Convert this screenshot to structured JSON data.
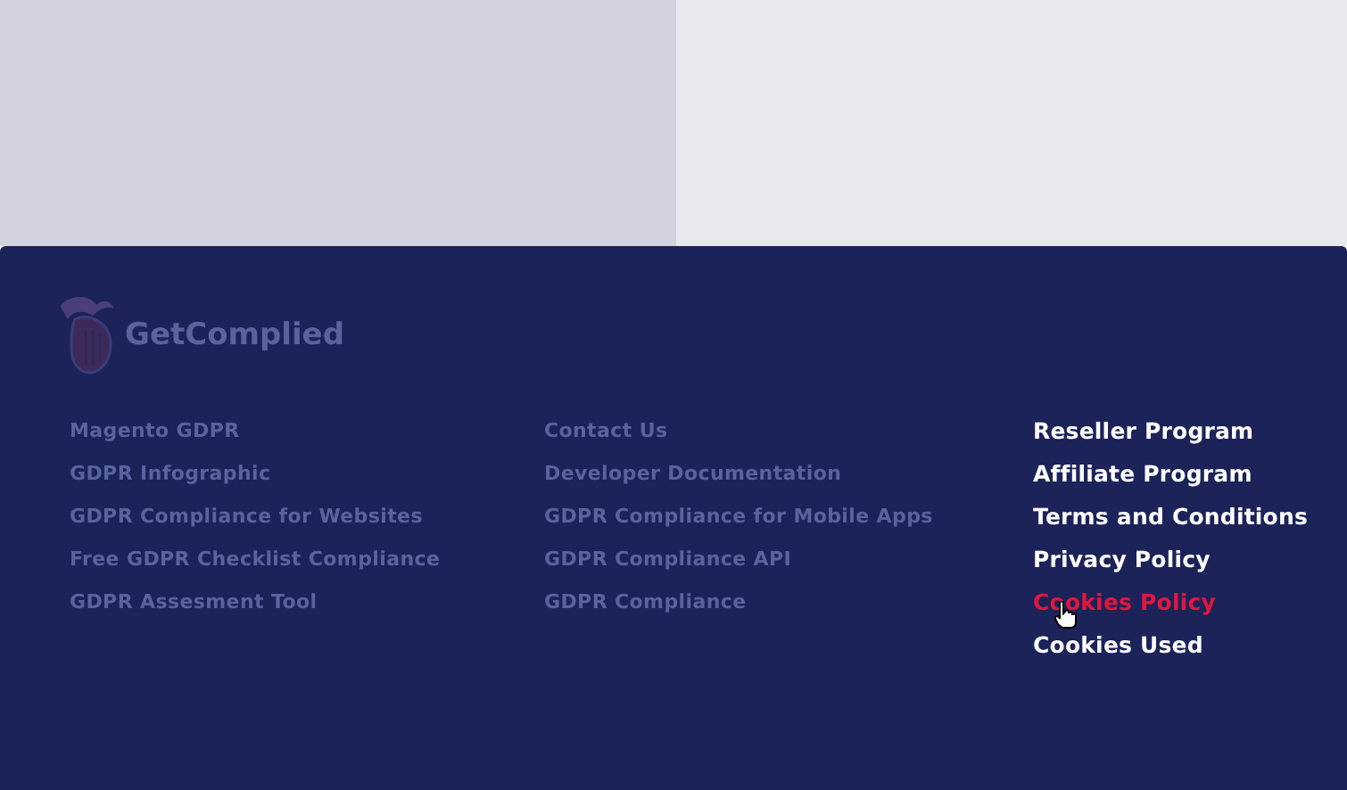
{
  "footer": {
    "logo": {
      "text": "GetComplied",
      "dimmed": true
    },
    "columns": [
      {
        "dimmed": true,
        "links": [
          {
            "label": "Magento GDPR",
            "hovered": false
          },
          {
            "label": "GDPR Infographic",
            "hovered": false
          },
          {
            "label": "GDPR Compliance for Websites",
            "hovered": false
          },
          {
            "label": "Free GDPR Checklist Compliance",
            "hovered": false
          },
          {
            "label": "GDPR Assesment Tool",
            "hovered": false
          }
        ]
      },
      {
        "dimmed": true,
        "links": [
          {
            "label": "Contact Us",
            "hovered": false
          },
          {
            "label": "Developer Documentation",
            "hovered": false
          },
          {
            "label": "GDPR Compliance for Mobile Apps",
            "hovered": false
          },
          {
            "label": "GDPR Compliance API",
            "hovered": false
          },
          {
            "label": "GDPR Compliance",
            "hovered": false
          }
        ]
      },
      {
        "dimmed": false,
        "links": [
          {
            "label": "Reseller Program",
            "hovered": false
          },
          {
            "label": "Affiliate Program",
            "hovered": false
          },
          {
            "label": "Terms and Conditions",
            "hovered": false
          },
          {
            "label": "Privacy Policy",
            "hovered": false
          },
          {
            "label": "Cookies Policy",
            "hovered": true
          },
          {
            "label": "Cookies Used",
            "hovered": false
          }
        ]
      }
    ]
  }
}
